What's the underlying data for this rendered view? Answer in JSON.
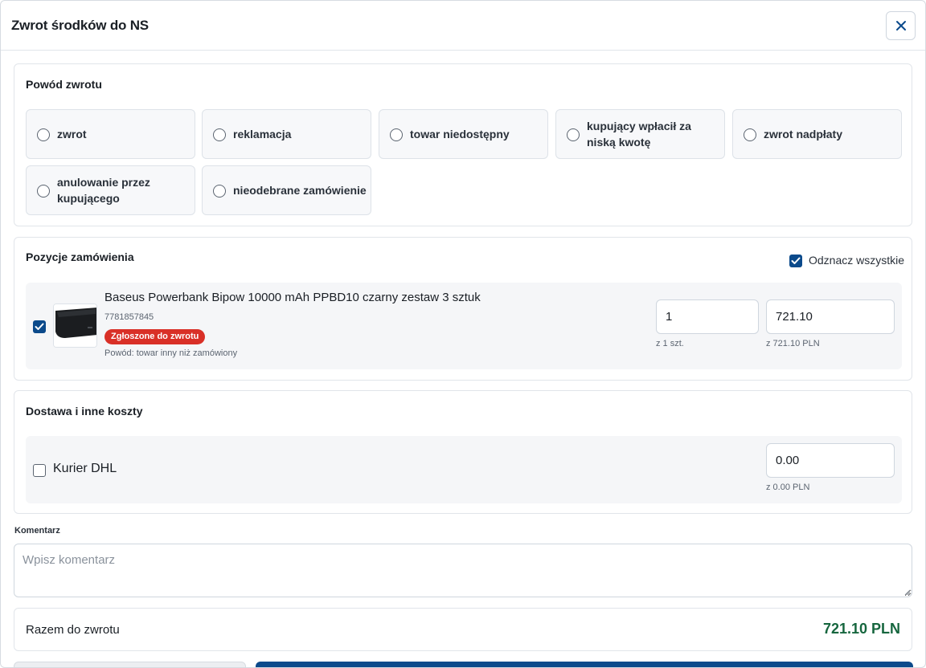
{
  "dialog": {
    "title": "Zwrot środków do NS"
  },
  "reason_section": {
    "title": "Powód zwrotu",
    "options": [
      {
        "label": "zwrot"
      },
      {
        "label": "reklamacja"
      },
      {
        "label": "towar niedostępny"
      },
      {
        "label": "kupujący wpłacił za niską kwotę"
      },
      {
        "label": "zwrot nadpłaty"
      },
      {
        "label": "anulowanie przez kupującego"
      },
      {
        "label": "nieodebrane zamówienie"
      }
    ]
  },
  "items_section": {
    "title": "Pozycje zamówienia",
    "toggle_all_label": "Odznacz wszystkie",
    "toggle_all_checked": true,
    "items": [
      {
        "checked": true,
        "name": "Baseus Powerbank Bipow 10000 mAh PPBD10 czarny zestaw 3 sztuk",
        "sku": "7781857845",
        "badge": "Zgłoszone do zwrotu",
        "reason": "Powód: towar inny niż zamówiony",
        "quantity": "1",
        "quantity_hint": "z 1 szt.",
        "amount": "721.10",
        "amount_hint": "z 721.10 PLN"
      }
    ]
  },
  "shipping_section": {
    "title": "Dostawa i inne koszty",
    "items": [
      {
        "checked": false,
        "label": "Kurier DHL",
        "amount": "0.00",
        "amount_hint": "z 0.00 PLN"
      }
    ]
  },
  "comment": {
    "label": "Komentarz",
    "placeholder": "Wpisz komentarz",
    "value": ""
  },
  "total": {
    "label": "Razem do zwrotu",
    "value": "721.10 PLN"
  },
  "icons": {
    "close": "close-icon",
    "check": "check-icon",
    "product": "powerbank-image"
  },
  "colors": {
    "primary": "#0b4a8b",
    "badge": "#d93027",
    "total": "#16663e"
  }
}
